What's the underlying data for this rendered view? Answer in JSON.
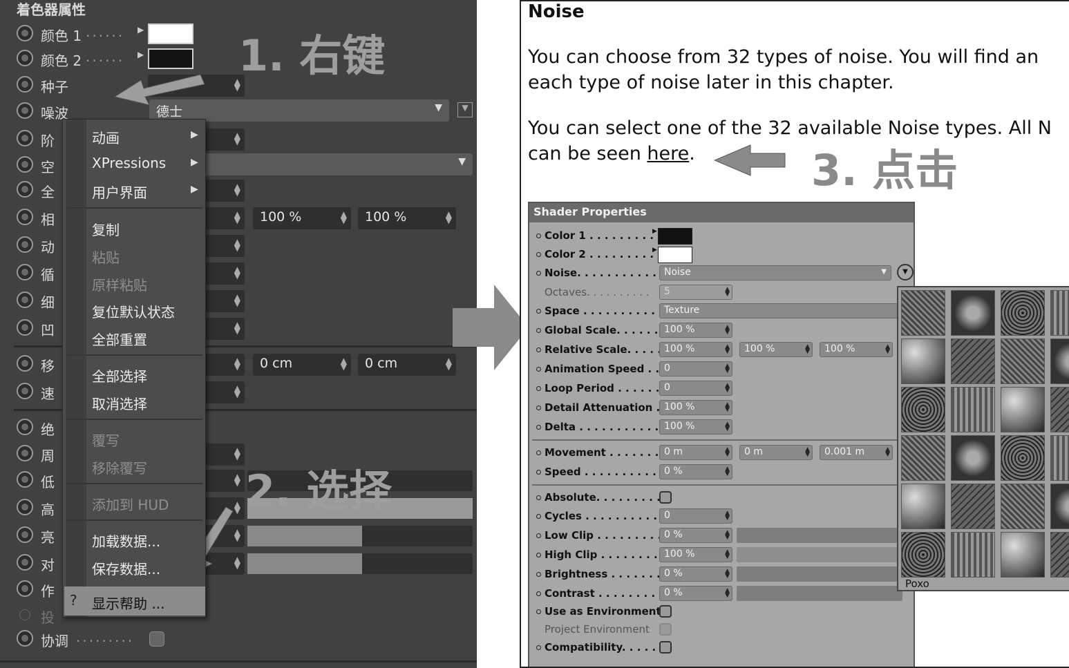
{
  "left": {
    "title": "着色器属性",
    "rows": {
      "color1": "颜色 1",
      "color2": "颜色 2",
      "seed": "种子",
      "noise": "噪波",
      "octaves": "阶",
      "space": "空",
      "global": "全",
      "relative": "相",
      "anim": "动",
      "loop": "循",
      "detail": "细",
      "bump": "凹",
      "move": "移",
      "speed": "速",
      "absolute": "绝",
      "cycles": "周",
      "lowclip": "低",
      "highclip": "高",
      "bright": "亮",
      "contrast": "对",
      "env": "作",
      "proj": "投",
      "compat": "协调"
    },
    "noise_value": "德士",
    "relative_values": [
      "100 %",
      "100 %"
    ],
    "move_values": [
      "0 cm",
      "0 cm"
    ],
    "context_menu": {
      "animation": "动画",
      "xpressions": "XPressions",
      "ui": "用户界面",
      "copy": "复制",
      "paste": "粘贴",
      "paste_raw": "原样粘贴",
      "reset_default": "复位默认状态",
      "reset_all": "全部重置",
      "select_all": "全部选择",
      "deselect": "取消选择",
      "override": "覆写",
      "remove_override": "移除覆写",
      "add_hud": "添加到 HUD",
      "load_data": "加载数据...",
      "save_data": "保存数据...",
      "show_help": "显示帮助 ..."
    },
    "annotations": {
      "step1": "1.  右键",
      "step2": "2.  选择"
    }
  },
  "right": {
    "heading": "Noise",
    "p1_line1": "You can choose from 32 types of noise. You will find an",
    "p1_line2": "each type of noise later in this chapter.",
    "p2_line1": "You can select one of the 32 available Noise types. All N",
    "p2_line2_pre": "can be seen ",
    "p2_link": "here",
    "p2_line2_post": ".",
    "annotation": "3.  点击",
    "shader": {
      "title": "Shader Properties",
      "rows": {
        "color1": "Color 1 . . . . . . . . .",
        "color2": "Color 2 . . . . . . . . .",
        "noise": "Noise. . . . . . . . . . . .",
        "octaves": "Octaves. . . . . . . . . .",
        "space": "Space . . . . . . . . . . .",
        "global": "Global Scale. . . . . . .",
        "relative": "Relative Scale. . . . . .",
        "anim": "Animation Speed . .",
        "loop": "Loop Period . . . . . . .",
        "detail": "Detail Attenuation .",
        "delta": "Delta . . . . . . . . . . . .",
        "move": "Movement . . . . . . . .",
        "speed": "Speed . . . . . . . . . . .",
        "absolute": "Absolute. . . . . . . . . .",
        "cycles": "Cycles . . . . . . . . . . .",
        "lowclip": "Low Clip . . . . . . . . .",
        "highclip": "High Clip . . . . . . . .",
        "bright": "Brightness . . . . . . . .",
        "contrast": "Contrast . . . . . . . . .",
        "env": "Use as Environment",
        "proj": "Project Environment",
        "compat": "Compatibility. . . . . ."
      },
      "values": {
        "noise": "Noise",
        "octaves": "5",
        "space": "Texture",
        "global": "100 %",
        "relative": [
          "100 %",
          "100 %",
          "100 %"
        ],
        "anim": "0",
        "loop": "0",
        "detail": "100 %",
        "delta": "100 %",
        "move": [
          "0 m",
          "0 m",
          "0.001 m"
        ],
        "speed": "0 %",
        "cycles": "0",
        "lowclip": "0 %",
        "highclip": "100 %",
        "bright": "0 %",
        "contrast": "0 %"
      },
      "popup_selected": "Poxo"
    }
  }
}
